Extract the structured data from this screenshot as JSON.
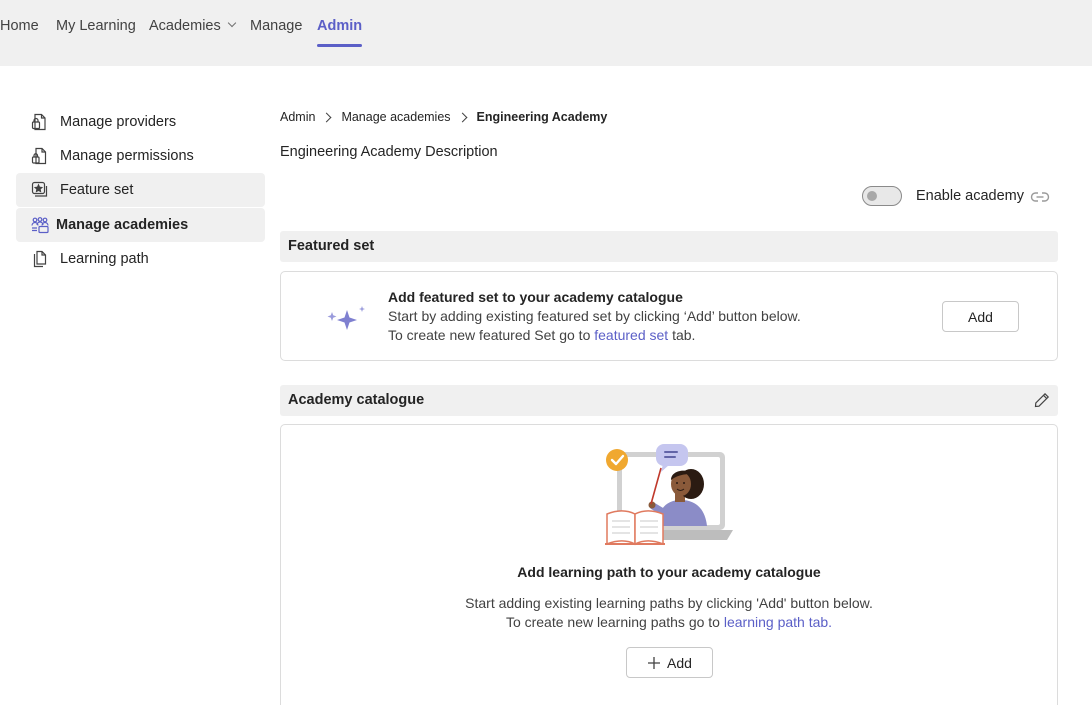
{
  "topnav": {
    "home": "Home",
    "my_learning": "My Learning",
    "academies": "Academies",
    "manage": "Manage",
    "admin": "Admin"
  },
  "sidebar": {
    "items": [
      {
        "label": "Manage providers",
        "icon": "provider-icon"
      },
      {
        "label": "Manage permissions",
        "icon": "lock-document-icon"
      },
      {
        "label": "Feature set",
        "icon": "star-stack-icon"
      },
      {
        "label": "Manage academies",
        "icon": "people-academy-icon",
        "selected": true
      },
      {
        "label": "Learning path",
        "icon": "document-copy-icon"
      }
    ]
  },
  "breadcrumb": [
    "Admin",
    "Manage academies",
    "Engineering Academy"
  ],
  "description": "Engineering Academy Description",
  "enable_toggle": {
    "label": "Enable academy",
    "on": false
  },
  "featured": {
    "header": "Featured set",
    "title": "Add featured set to your academy catalogue",
    "line1": "Start by adding existing featured set by clicking ‘Add’ button below.",
    "line2_prefix": "To create new featured Set go to ",
    "line2_link": "featured set",
    "line2_suffix": " tab.",
    "add_button": "Add"
  },
  "catalogue": {
    "header": "Academy catalogue",
    "title": "Add learning path to your academy catalogue",
    "line1": "Start adding existing learning paths by clicking 'Add' button below.",
    "line2_prefix": "To create new learning paths go to ",
    "line2_link": "learning path tab.",
    "add_button": "Add"
  },
  "colors": {
    "accent": "#5b5fc7",
    "nav_bg": "#f0f0f0"
  }
}
